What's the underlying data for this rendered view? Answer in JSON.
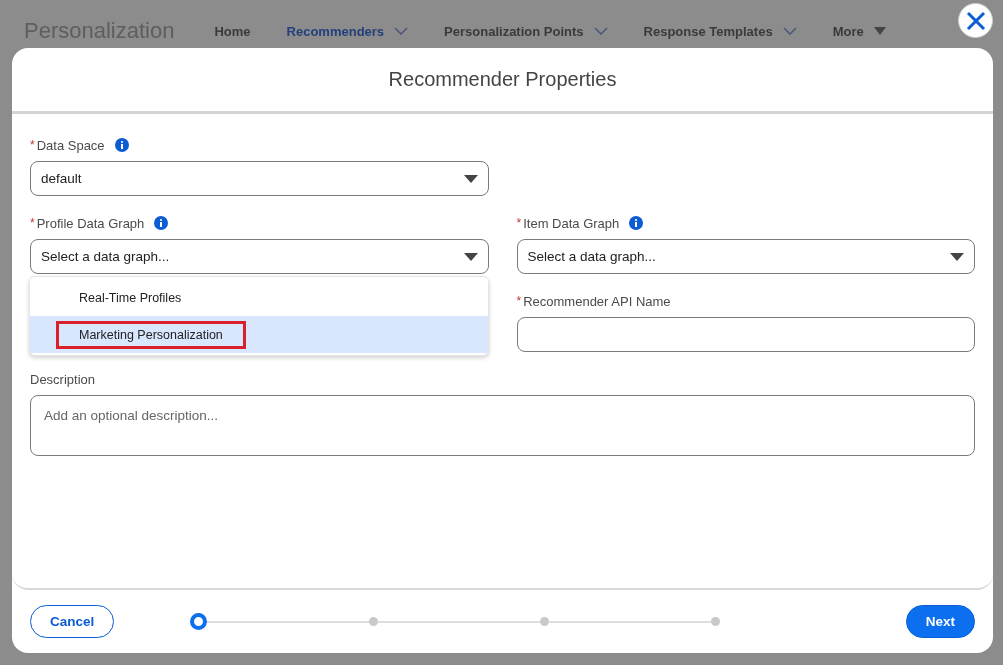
{
  "app": {
    "title": "Personalization",
    "nav": [
      {
        "label": "Home",
        "selected": false,
        "menu": false
      },
      {
        "label": "Recommenders",
        "selected": true,
        "menu": true
      },
      {
        "label": "Personalization Points",
        "selected": false,
        "menu": true
      },
      {
        "label": "Response Templates",
        "selected": false,
        "menu": true
      },
      {
        "label": "More",
        "selected": false,
        "menu": true
      }
    ]
  },
  "modal": {
    "title": "Recommender Properties",
    "data_space": {
      "required_mark": "*",
      "label": "Data Space",
      "info": true,
      "value": "default"
    },
    "profile_data_graph": {
      "required_mark": "*",
      "label": "Profile Data Graph",
      "info": true,
      "placeholder": "Select a data graph...",
      "expanded": true,
      "options": [
        {
          "label": "Real-Time Profiles",
          "selected": false,
          "annotated": false
        },
        {
          "label": "Marketing Personalization",
          "selected": true,
          "annotated": true
        }
      ]
    },
    "item_data_graph": {
      "required_mark": "*",
      "label": "Item Data Graph",
      "info": true,
      "placeholder": "Select a data graph..."
    },
    "api_name": {
      "required_mark": "*",
      "label": "Recommender API Name"
    },
    "description": {
      "label": "Description",
      "placeholder": "Add an optional description..."
    },
    "footer": {
      "cancel": "Cancel",
      "next": "Next",
      "steps": [
        {
          "selected": true
        },
        {
          "selected": false
        },
        {
          "selected": false
        },
        {
          "selected": false
        }
      ]
    }
  }
}
